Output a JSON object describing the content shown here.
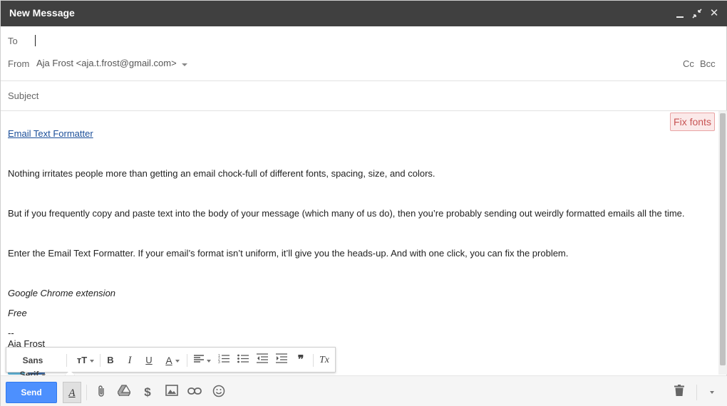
{
  "window": {
    "title": "New Message"
  },
  "titlebar": {
    "minimize_icon": "minimize-icon",
    "exit_fullscreen_icon": "exit-fullscreen-icon",
    "close_icon": "close-icon"
  },
  "fields": {
    "to_label": "To",
    "to_value": "",
    "from_label": "From",
    "from_value": "Aja Frost <aja.t.frost@gmail.com>",
    "cc_label": "Cc",
    "bcc_label": "Bcc",
    "subject_label": "Subject",
    "subject_value": ""
  },
  "body": {
    "fix_fonts_label": "Fix fonts",
    "link_text": "Email Text Formatter",
    "paragraphs": [
      "Nothing irritates people more than getting an email chock-full of different fonts, spacing, size, and colors.",
      "But if you frequently copy and paste text into the body of your message (which many of us do), then you’re probably sending out weirdly formatted emails all the time.",
      "Enter the Email Text Formatter. If your email’s format isn’t uniform, it’ll give you the heads-up. And with one click, you can fix the problem."
    ],
    "italic_1": "Google Chrome extension",
    "italic_2": "Free",
    "sig_dashes": "--",
    "sig_name": "Aja Frost"
  },
  "formatting_toolbar": {
    "font_label": "Sans Serif",
    "size_glyph": "тТ",
    "bold_glyph": "B",
    "italic_glyph": "I",
    "underline_glyph": "U",
    "color_glyph": "A",
    "quote_glyph": "❞",
    "clear_glyph": "Tx"
  },
  "bottom_bar": {
    "send_label": "Send",
    "format_glyph": "A",
    "money_glyph": "$"
  },
  "colors": {
    "send": "#4d90fe",
    "titlebar": "#404040",
    "link": "#1a4e99",
    "fix_fonts": "#c75454"
  }
}
